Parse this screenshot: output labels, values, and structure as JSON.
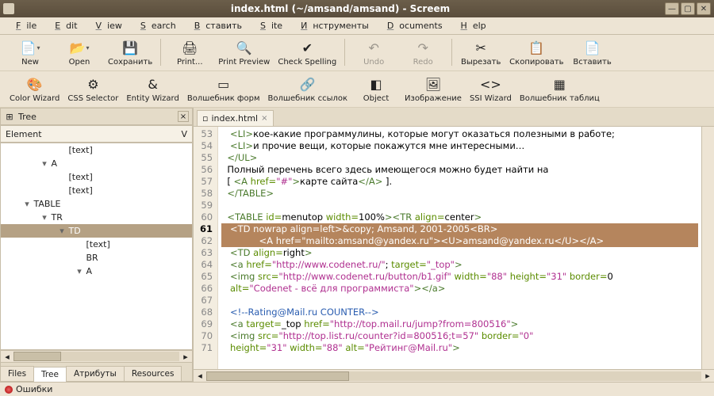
{
  "title": "index.html (~/amsand/amsand) - Screem",
  "menu": [
    "File",
    "Edit",
    "View",
    "Search",
    "Вставить",
    "Site",
    "Инструменты",
    "Documents",
    "Help"
  ],
  "toolbar1": [
    {
      "label": "New",
      "icon": "📄",
      "dd": true
    },
    {
      "label": "Open",
      "icon": "📂",
      "dd": true
    },
    {
      "label": "Сохранить",
      "icon": "💾"
    },
    {
      "sep": true
    },
    {
      "label": "Print...",
      "icon": "🖨"
    },
    {
      "label": "Print Preview",
      "icon": "🔍"
    },
    {
      "label": "Check Spelling",
      "icon": "✔"
    },
    {
      "sep": true
    },
    {
      "label": "Undo",
      "icon": "↶",
      "disabled": true
    },
    {
      "label": "Redo",
      "icon": "↷",
      "disabled": true
    },
    {
      "sep": true
    },
    {
      "label": "Вырезать",
      "icon": "✂"
    },
    {
      "label": "Скопировать",
      "icon": "📋"
    },
    {
      "label": "Вставить",
      "icon": "📄"
    }
  ],
  "toolbar2": [
    {
      "label": "Color Wizard",
      "icon": "🎨"
    },
    {
      "label": "CSS Selector",
      "icon": "⚙"
    },
    {
      "label": "Entity Wizard",
      "icon": "&"
    },
    {
      "label": "Волшебник форм",
      "icon": "▭"
    },
    {
      "label": "Волшебник ссылок",
      "icon": "🔗"
    },
    {
      "label": "Object",
      "icon": "◧"
    },
    {
      "label": "Изображение",
      "icon": "🖼"
    },
    {
      "label": "SSI Wizard",
      "icon": "<>"
    },
    {
      "label": "Волшебник таблиц",
      "icon": "▦"
    }
  ],
  "left_panel": {
    "title": "Tree",
    "element_label": "Element",
    "element_value": "V",
    "tabs": [
      "Files",
      "Tree",
      "Атрибуты",
      "Resources"
    ],
    "active_tab": "Tree",
    "tree": [
      {
        "indent": 3,
        "tw": "",
        "label": "[text]"
      },
      {
        "indent": 2,
        "tw": "▾",
        "label": "A"
      },
      {
        "indent": 3,
        "tw": "",
        "label": "[text]"
      },
      {
        "indent": 3,
        "tw": "",
        "label": "[text]"
      },
      {
        "indent": 1,
        "tw": "▾",
        "label": "TABLE"
      },
      {
        "indent": 2,
        "tw": "▾",
        "label": "TR"
      },
      {
        "indent": 3,
        "tw": "▾",
        "label": "TD",
        "sel": true
      },
      {
        "indent": 4,
        "tw": "",
        "label": "[text]"
      },
      {
        "indent": 4,
        "tw": "",
        "label": "BR"
      },
      {
        "indent": 4,
        "tw": "▾",
        "label": "A"
      }
    ]
  },
  "editor": {
    "filename": "index.html",
    "first_line": 53,
    "lines": [
      {
        "n": 53,
        "html": "   <span class='t-tag'>&lt;LI&gt;</span><span class='t-text'>кое-какие программулины, которые могут оказаться полезными в работе;</span>"
      },
      {
        "n": 54,
        "html": "   <span class='t-tag'>&lt;LI&gt;</span><span class='t-text'>и прочие вещи, которые покажутся мне интересными…</span>"
      },
      {
        "n": 55,
        "html": "  <span class='t-tag'>&lt;/UL&gt;</span>"
      },
      {
        "n": 56,
        "html": "  <span class='t-text'>Полный перечень всего здесь имеющегося можно будет найти на</span>"
      },
      {
        "n": 57,
        "html": "  <span class='t-text'>[ </span><span class='t-tag'>&lt;A </span><span class='t-attr'>href=</span><span class='t-str'>\"#\"</span><span class='t-tag'>&gt;</span><span class='t-text'>карте сайта</span><span class='t-tag'>&lt;/A&gt;</span><span class='t-text'> ].</span>"
      },
      {
        "n": 58,
        "html": "  <span class='t-tag'>&lt;/TABLE&gt;</span>"
      },
      {
        "n": 59,
        "html": ""
      },
      {
        "n": 60,
        "html": "  <span class='t-tag'>&lt;TABLE </span><span class='t-attr'>id=</span><span class='t-text'>menutop </span><span class='t-attr'>width=</span><span class='t-text'>100%</span><span class='t-tag'>&gt;&lt;TR </span><span class='t-attr'>align=</span><span class='t-text'>center</span><span class='t-tag'>&gt;</span>"
      },
      {
        "n": 61,
        "sel": true,
        "html": "   &lt;TD nowrap align=left&gt;&amp;copy; Amsand, 2001-2005&lt;BR&gt;"
      },
      {
        "n": 62,
        "sel": true,
        "html": "             &lt;A href=\"mailto:amsand@yandex.ru\"&gt;&lt;U&gt;amsand@yandex.ru&lt;/U&gt;&lt;/A&gt;"
      },
      {
        "n": 63,
        "html": "   <span class='t-tag'>&lt;TD </span><span class='t-attr'>align=</span><span class='t-text'>right</span><span class='t-tag'>&gt;</span>"
      },
      {
        "n": 64,
        "html": "   <span class='t-tag'>&lt;a </span><span class='t-attr'>href=</span><span class='t-str'>\"http://www.codenet.ru/\"</span><span class='t-text'>; </span><span class='t-attr'>target=</span><span class='t-str'>\"_top\"</span><span class='t-tag'>&gt;</span>"
      },
      {
        "n": 65,
        "html": "   <span class='t-tag'>&lt;img </span><span class='t-attr'>src=</span><span class='t-str'>\"http://www.codenet.ru/button/b1.gif\"</span> <span class='t-attr'>width=</span><span class='t-str'>\"88\"</span> <span class='t-attr'>height=</span><span class='t-str'>\"31\"</span> <span class='t-attr'>border=</span><span class='t-text'>0</span>"
      },
      {
        "n": 66,
        "html": "   <span class='t-attr'>alt=</span><span class='t-str'>\"Codenet - всё для программиста\"</span><span class='t-tag'>&gt;&lt;/a&gt;</span>"
      },
      {
        "n": 67,
        "html": ""
      },
      {
        "n": 68,
        "html": "   <span class='t-cmt'>&lt;!--Rating@Mail.ru COUNTER--&gt;</span>"
      },
      {
        "n": 69,
        "html": "   <span class='t-tag'>&lt;a </span><span class='t-attr'>target=</span><span class='t-text'>_top </span><span class='t-attr'>href=</span><span class='t-str'>\"http://top.mail.ru/jump?from=800516\"</span><span class='t-tag'>&gt;</span>"
      },
      {
        "n": 70,
        "html": "   <span class='t-tag'>&lt;img </span><span class='t-attr'>src=</span><span class='t-str'>\"http://top.list.ru/counter?id=800516;t=57\"</span> <span class='t-attr'>border=</span><span class='t-str'>\"0\"</span>"
      },
      {
        "n": 71,
        "html": "   <span class='t-attr'>height=</span><span class='t-str'>\"31\"</span> <span class='t-attr'>width=</span><span class='t-str'>\"88\"</span> <span class='t-attr'>alt=</span><span class='t-str'>\"Рейтинг@Mail.ru\"</span><span class='t-tag'>&gt;</span>"
      }
    ]
  },
  "status": "Ошибки"
}
